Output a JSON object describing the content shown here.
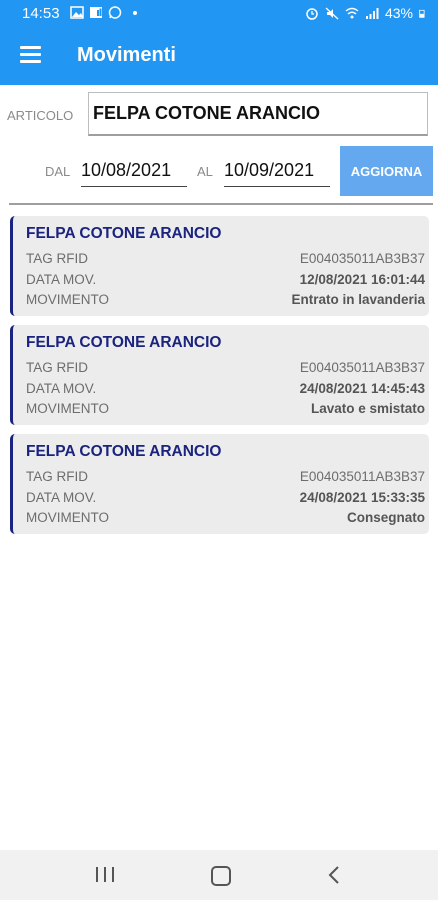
{
  "status_bar": {
    "time": "14:53",
    "battery": "43%",
    "left_icons": [
      "gallery-icon",
      "sim-icon",
      "whatsapp-icon",
      "notification-dot-icon"
    ],
    "right_icons": [
      "alarm-icon",
      "mute-icon",
      "wifi-icon",
      "signal-icon",
      "battery-icon"
    ]
  },
  "app_bar": {
    "title": "Movimenti",
    "menu_icon": "hamburger-menu-icon"
  },
  "filter": {
    "articolo_label": "ARTICOLO",
    "articolo_value": "FELPA COTONE ARANCIO",
    "dal_label": "DAL",
    "dal_value": "10/08/2021",
    "al_label": "AL",
    "al_value": "10/09/2021",
    "aggiorna_label": "AGGIORNA"
  },
  "accent_colors": {
    "primary": "#2196f3",
    "button": "#64a8ef",
    "card_title": "#1a237e"
  },
  "movements": [
    {
      "title": "FELPA COTONE ARANCIO",
      "tag_label": "TAG RFID",
      "tag_value": "E004035011AB3B37",
      "date_label": "DATA MOV.",
      "date_value": "12/08/2021 16:01:44",
      "mov_label": "MOVIMENTO",
      "mov_value": "Entrato in lavanderia"
    },
    {
      "title": "FELPA COTONE ARANCIO",
      "tag_label": "TAG RFID",
      "tag_value": "E004035011AB3B37",
      "date_label": "DATA MOV.",
      "date_value": "24/08/2021 14:45:43",
      "mov_label": "MOVIMENTO",
      "mov_value": "Lavato e smistato"
    },
    {
      "title": "FELPA COTONE ARANCIO",
      "tag_label": "TAG RFID",
      "tag_value": "E004035011AB3B37",
      "date_label": "DATA MOV.",
      "date_value": "24/08/2021 15:33:35",
      "mov_label": "MOVIMENTO",
      "mov_value": "Consegnato"
    }
  ],
  "nav_bar": {
    "recents_icon": "recents-icon",
    "home_icon": "home-icon",
    "back_icon": "back-icon"
  }
}
